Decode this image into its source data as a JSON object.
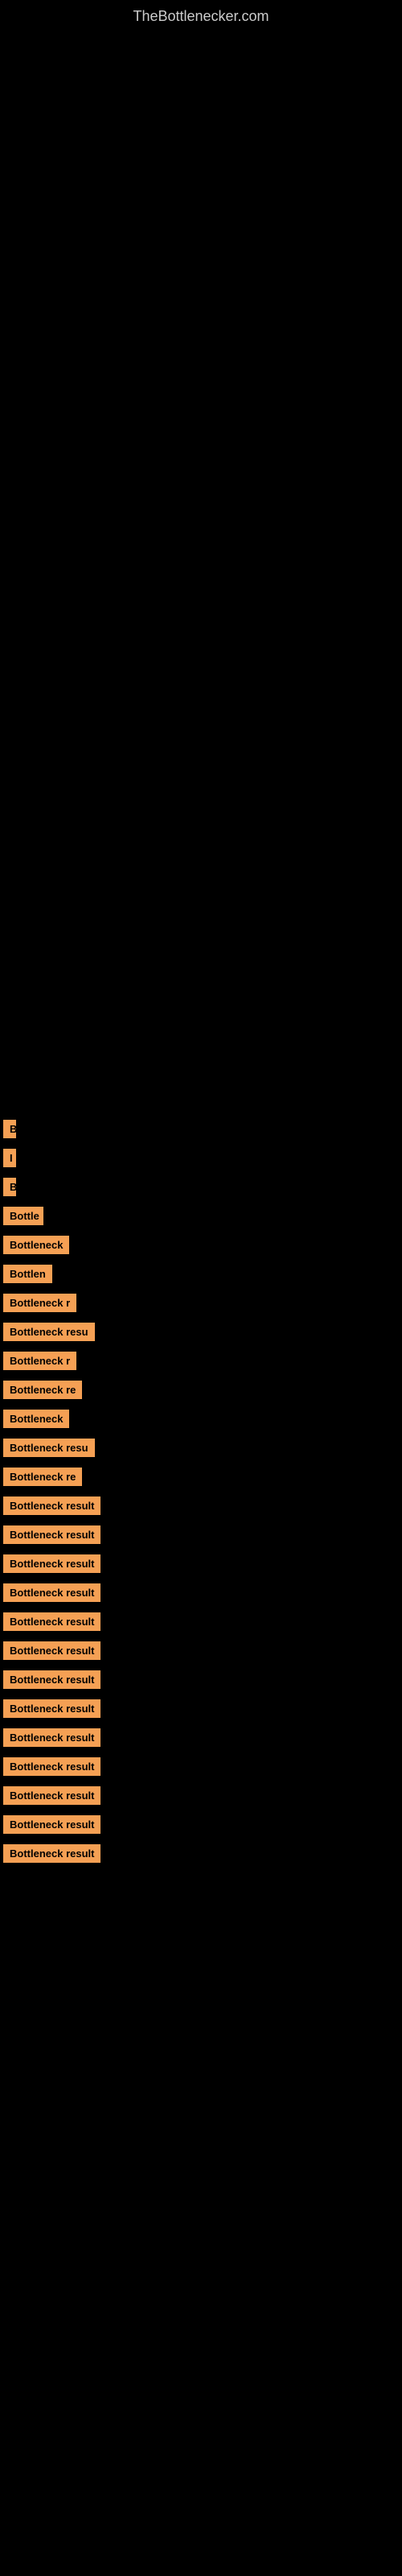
{
  "site": {
    "title": "TheBottlenecker.com"
  },
  "items": [
    {
      "label": "B",
      "width": 14
    },
    {
      "label": "I",
      "width": 14
    },
    {
      "label": "B",
      "width": 14
    },
    {
      "label": "Bottle",
      "width": 50
    },
    {
      "label": "Bottleneck",
      "width": 88
    },
    {
      "label": "Bottlen",
      "width": 72
    },
    {
      "label": "Bottleneck r",
      "width": 100
    },
    {
      "label": "Bottleneck resu",
      "width": 125
    },
    {
      "label": "Bottleneck r",
      "width": 100
    },
    {
      "label": "Bottleneck re",
      "width": 115
    },
    {
      "label": "Bottleneck",
      "width": 88
    },
    {
      "label": "Bottleneck resu",
      "width": 130
    },
    {
      "label": "Bottleneck re",
      "width": 115
    },
    {
      "label": "Bottleneck result",
      "width": 155
    },
    {
      "label": "Bottleneck result",
      "width": 160
    },
    {
      "label": "Bottleneck result",
      "width": 165
    },
    {
      "label": "Bottleneck result",
      "width": 165
    },
    {
      "label": "Bottleneck result",
      "width": 165
    },
    {
      "label": "Bottleneck result",
      "width": 165
    },
    {
      "label": "Bottleneck result",
      "width": 165
    },
    {
      "label": "Bottleneck result",
      "width": 165
    },
    {
      "label": "Bottleneck result",
      "width": 165
    },
    {
      "label": "Bottleneck result",
      "width": 165
    },
    {
      "label": "Bottleneck result",
      "width": 165
    },
    {
      "label": "Bottleneck result",
      "width": 165
    },
    {
      "label": "Bottleneck result",
      "width": 165
    }
  ],
  "colors": {
    "background": "#000000",
    "label_bg": "#f5a054",
    "label_text": "#000000",
    "title": "#cccccc"
  }
}
